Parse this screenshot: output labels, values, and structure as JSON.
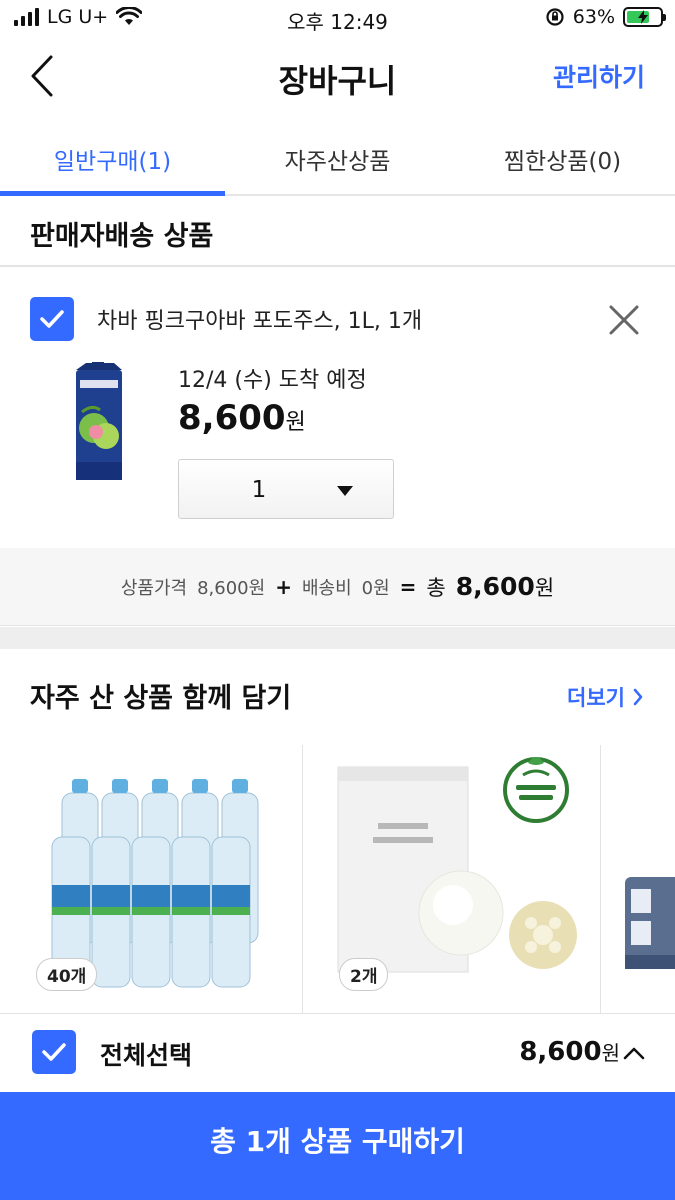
{
  "status_bar": {
    "carrier": "LG U+",
    "time": "오후 12:49",
    "battery_percent": "63%"
  },
  "header": {
    "title": "장바구니",
    "manage_label": "관리하기",
    "back_icon": "chevron-left-icon"
  },
  "tabs": [
    {
      "label": "일반구매(1)",
      "active": true
    },
    {
      "label": "자주산상품",
      "active": false
    },
    {
      "label": "찜한상품(0)",
      "active": false
    }
  ],
  "section_title": "판매자배송 상품",
  "cart_item": {
    "checked": true,
    "name": "차바 핑크구아바 포도주스, 1L, 1개",
    "delivery": "12/4 (수) 도착 예정",
    "price": "8,600",
    "currency": "원",
    "quantity": "1"
  },
  "summary": {
    "product_price_label": "상품가격",
    "product_price": "8,600원",
    "plus": "+",
    "shipping_label": "배송비",
    "shipping": "0원",
    "equals": "=",
    "total_label": "총",
    "total": "8,600",
    "currency": "원"
  },
  "frequent": {
    "title": "자주 산 상품 함께 담기",
    "more_label": "더보기",
    "items": [
      {
        "badge": "40개"
      },
      {
        "badge": "2개"
      }
    ]
  },
  "bottom": {
    "select_all_label": "전체선택",
    "total": "8,600",
    "currency": "원",
    "buy_label": "총 1개 상품 구매하기"
  },
  "colors": {
    "accent": "#346aff"
  }
}
